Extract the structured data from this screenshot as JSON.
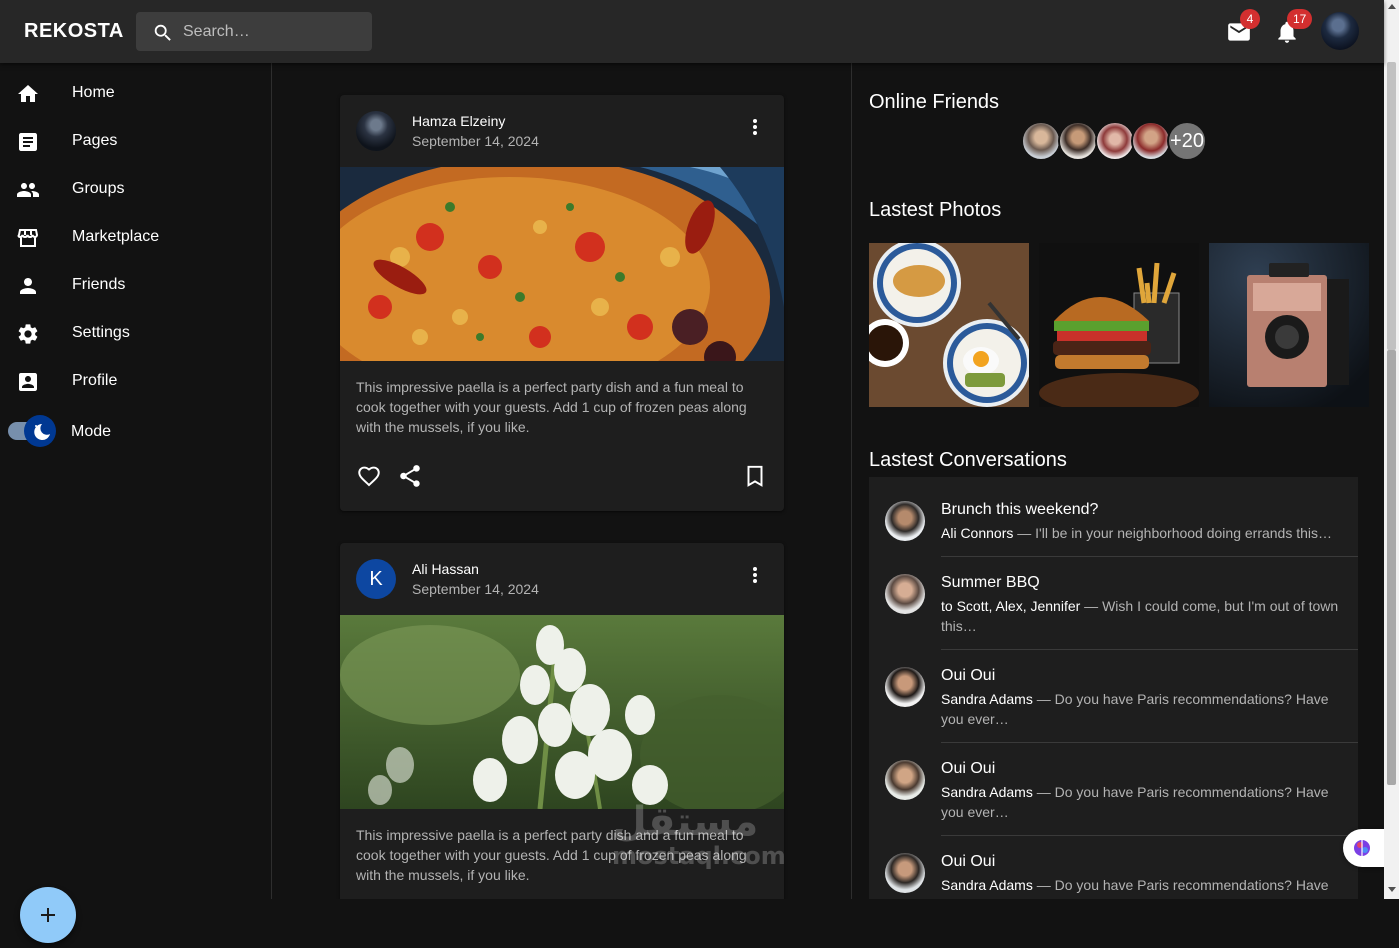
{
  "header": {
    "brand": "REKOSTA",
    "search_placeholder": "Search…",
    "mail_count": "4",
    "notif_count": "17"
  },
  "sidebar": {
    "items": [
      {
        "label": "Home",
        "icon": "home-icon"
      },
      {
        "label": "Pages",
        "icon": "article-icon"
      },
      {
        "label": "Groups",
        "icon": "group-icon"
      },
      {
        "label": "Marketplace",
        "icon": "storefront-icon"
      },
      {
        "label": "Friends",
        "icon": "person-icon"
      },
      {
        "label": "Settings",
        "icon": "settings-icon"
      },
      {
        "label": "Profile",
        "icon": "account-box-icon"
      }
    ],
    "mode_label": "Mode"
  },
  "posts": [
    {
      "author": "Hamza Elzeiny",
      "date": "September 14, 2024",
      "text": "This impressive paella is a perfect party dish and a fun meal to cook together with your guests. Add 1 cup of frozen peas along with the mussels, if you like."
    },
    {
      "author": "Ali Hassan",
      "avatar_letter": "K",
      "date": "September 14, 2024",
      "text": "This impressive paella is a perfect party dish and a fun meal to cook together with your guests. Add 1 cup of frozen peas along with the mussels, if you like."
    }
  ],
  "right": {
    "online_title": "Online Friends",
    "online_more": "+20",
    "photos_title": "Lastest Photos",
    "conversations_title": "Lastest Conversations",
    "conversations": [
      {
        "title": "Brunch this weekend?",
        "from": "Ali Connors",
        "snippet": " — I'll be in your neighborhood doing errands this…"
      },
      {
        "title": "Summer BBQ",
        "from": "to Scott, Alex, Jennifer",
        "snippet": " — Wish I could come, but I'm out of town this…"
      },
      {
        "title": "Oui Oui",
        "from": "Sandra Adams",
        "snippet": " — Do you have Paris recommendations? Have you ever…"
      },
      {
        "title": "Oui Oui",
        "from": "Sandra Adams",
        "snippet": " — Do you have Paris recommendations? Have you ever…"
      },
      {
        "title": "Oui Oui",
        "from": "Sandra Adams",
        "snippet": " — Do you have Paris recommendations? Have you ever…"
      }
    ]
  },
  "watermark": {
    "arabic": "مستقل",
    "latin": "mostaql.com"
  },
  "colors": {
    "appbar": "#272727",
    "surface": "#1e1e1e",
    "background": "#121212",
    "badge": "#d32f2f",
    "fab": "#90caf9",
    "toggle_knob": "#003892",
    "letter_avatar": "#0d47a1"
  }
}
